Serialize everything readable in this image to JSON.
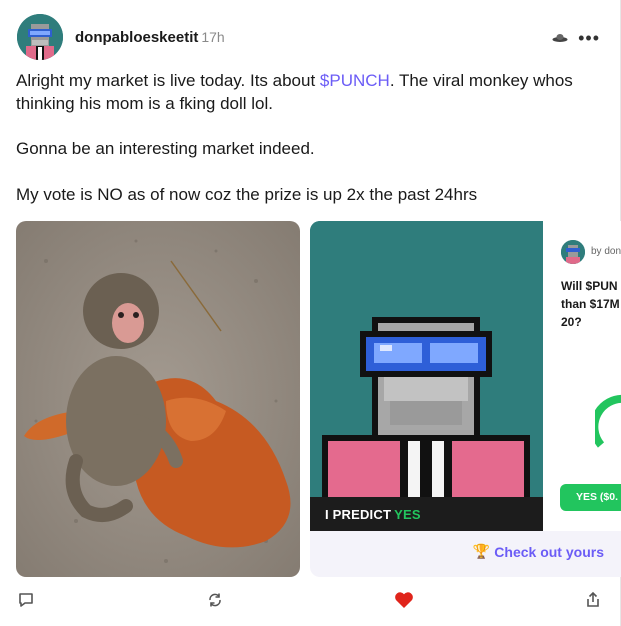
{
  "post": {
    "username": "donpabloeskeetit",
    "time": "17h",
    "more_label": "•••",
    "paragraph1_before": "Alright my market is live today. Its about ",
    "ticker": "$PUNCH",
    "paragraph1_after": ". The viral monkey whos thinking his mom is a fking doll lol.",
    "paragraph2": "Gonna be an interesting market indeed.",
    "paragraph3": "My vote is NO as of now coz the prize is up 2x the past 24hrs"
  },
  "prediction": {
    "label": "I PREDICT",
    "choice": "YES"
  },
  "market": {
    "by": "by don",
    "question": "Will $PUN\nthan $17M\n20?",
    "yes_button": "YES ($0.",
    "checkout_label": "Check out yours",
    "checkout_icon": "trophy-icon",
    "gauge_color": "#22c55e"
  },
  "colors": {
    "accent": "#6b5cf6",
    "teal": "#2f7d7c",
    "heart": "#e0241b",
    "yes_green": "#22c55e"
  },
  "actions": [
    "comment-icon",
    "repost-icon",
    "heart-icon",
    "share-icon"
  ]
}
